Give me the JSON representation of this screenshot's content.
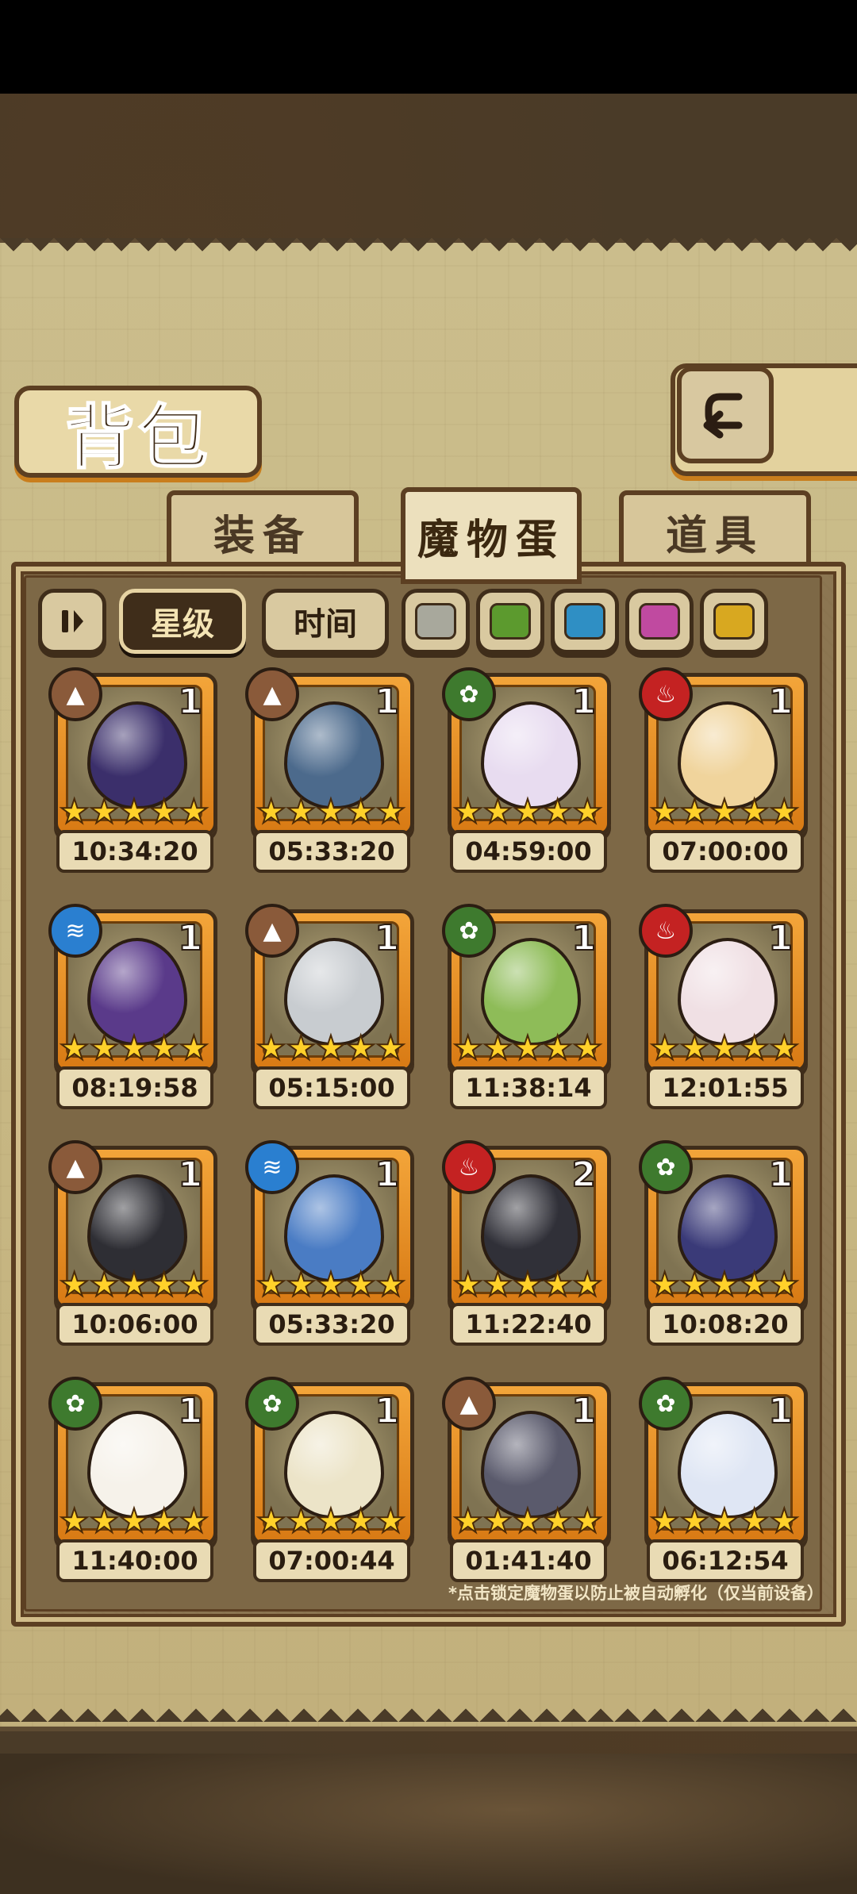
{
  "header": {
    "title": "背包"
  },
  "tabs": [
    {
      "label": "装备",
      "active": false
    },
    {
      "label": "魔物蛋",
      "active": true
    },
    {
      "label": "道具",
      "active": false
    }
  ],
  "filters": {
    "sort_toggle_icon": "pause-icon",
    "star_label": "星级",
    "time_label": "时间",
    "colors": [
      "#a8a89c",
      "#5c9a2e",
      "#2f8fc4",
      "#c04aa0",
      "#d8a820"
    ]
  },
  "eggs": [
    {
      "element": "earth",
      "count": "1",
      "timer": "10:34:20",
      "color": "#3b2f6b",
      "stars": 5
    },
    {
      "element": "earth",
      "count": "1",
      "timer": "05:33:20",
      "color": "#4c6a8c",
      "stars": 5
    },
    {
      "element": "nature",
      "count": "1",
      "timer": "04:59:00",
      "color": "#e8dcf0",
      "stars": 5
    },
    {
      "element": "fire",
      "count": "1",
      "timer": "07:00:00",
      "color": "#f0d49c",
      "stars": 5
    },
    {
      "element": "water",
      "count": "1",
      "timer": "08:19:58",
      "color": "#5a3a8a",
      "stars": 5
    },
    {
      "element": "earth",
      "count": "1",
      "timer": "05:15:00",
      "color": "#c8ccd0",
      "stars": 5
    },
    {
      "element": "nature",
      "count": "1",
      "timer": "11:38:14",
      "color": "#8ebc58",
      "stars": 5
    },
    {
      "element": "fire",
      "count": "1",
      "timer": "12:01:55",
      "color": "#f0e0e4",
      "stars": 5
    },
    {
      "element": "earth",
      "count": "1",
      "timer": "10:06:00",
      "color": "#2e2e34",
      "stars": 5
    },
    {
      "element": "water",
      "count": "1",
      "timer": "05:33:20",
      "color": "#4a7cc4",
      "stars": 5
    },
    {
      "element": "fire",
      "count": "2",
      "timer": "11:22:40",
      "color": "#303038",
      "stars": 5
    },
    {
      "element": "nature",
      "count": "1",
      "timer": "10:08:20",
      "color": "#3a3a78",
      "stars": 5
    },
    {
      "element": "nature",
      "count": "1",
      "timer": "11:40:00",
      "color": "#f6f2ea",
      "stars": 5
    },
    {
      "element": "nature",
      "count": "1",
      "timer": "07:00:44",
      "color": "#ece4c8",
      "stars": 5
    },
    {
      "element": "earth",
      "count": "1",
      "timer": "01:41:40",
      "color": "#5a5a6c",
      "stars": 5
    },
    {
      "element": "nature",
      "count": "1",
      "timer": "06:12:54",
      "color": "#dfe6f4",
      "stars": 5
    }
  ],
  "element_styles": {
    "earth": {
      "bg": "#8a5a3a",
      "glyph": "▲"
    },
    "nature": {
      "bg": "#3e7a2e",
      "glyph": "✿"
    },
    "fire": {
      "bg": "#c42222",
      "glyph": "♨"
    },
    "water": {
      "bg": "#2a7fd0",
      "glyph": "≋"
    }
  },
  "footnote": "*点击锁定魔物蛋以防止被自动孵化（仅当前设备）"
}
